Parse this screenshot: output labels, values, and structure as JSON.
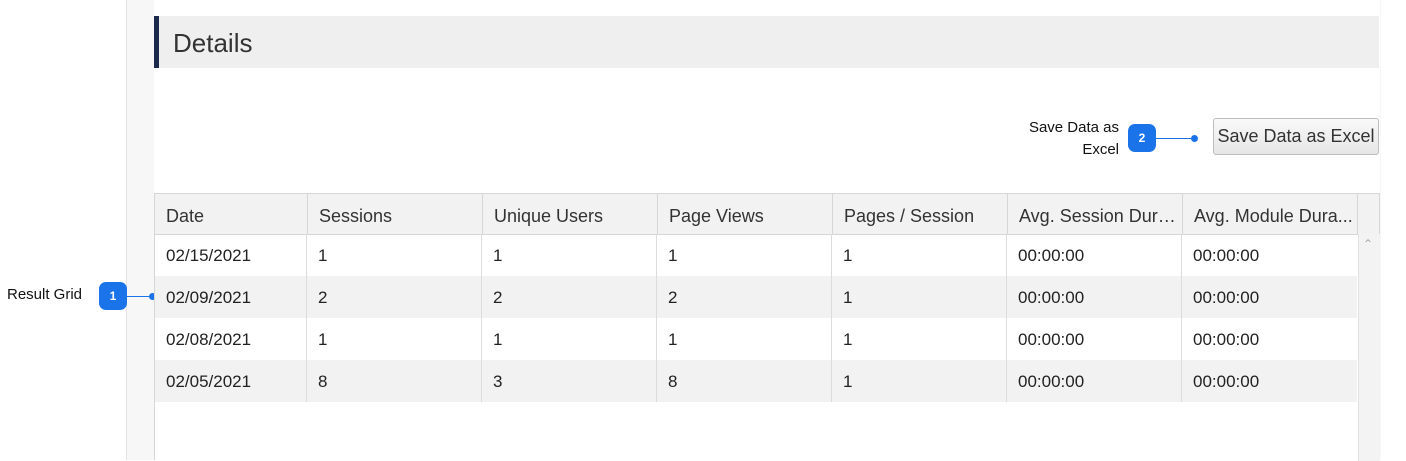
{
  "section": {
    "title": "Details"
  },
  "toolbar": {
    "save_excel_label": "Save Data as Excel"
  },
  "callouts": {
    "two": {
      "number": "2",
      "line1": "Save Data as",
      "line2": "Excel"
    },
    "one": {
      "number": "1",
      "label": "Result Grid"
    }
  },
  "grid": {
    "columns": [
      "Date",
      "Sessions",
      "Unique Users",
      "Page Views",
      "Pages / Session",
      "Avg. Session Dura...",
      "Avg. Module Dura..."
    ],
    "rows": [
      [
        "02/15/2021",
        "1",
        "1",
        "1",
        "1",
        "00:00:00",
        "00:00:00"
      ],
      [
        "02/09/2021",
        "2",
        "2",
        "2",
        "1",
        "00:00:00",
        "00:00:00"
      ],
      [
        "02/08/2021",
        "1",
        "1",
        "1",
        "1",
        "00:00:00",
        "00:00:00"
      ],
      [
        "02/05/2021",
        "8",
        "3",
        "8",
        "1",
        "00:00:00",
        "00:00:00"
      ]
    ]
  },
  "icons": {
    "scroll_up": "chevron-up-icon"
  },
  "colors": {
    "accent": "#1a73e8",
    "header_bar": "#1b2a4a"
  }
}
